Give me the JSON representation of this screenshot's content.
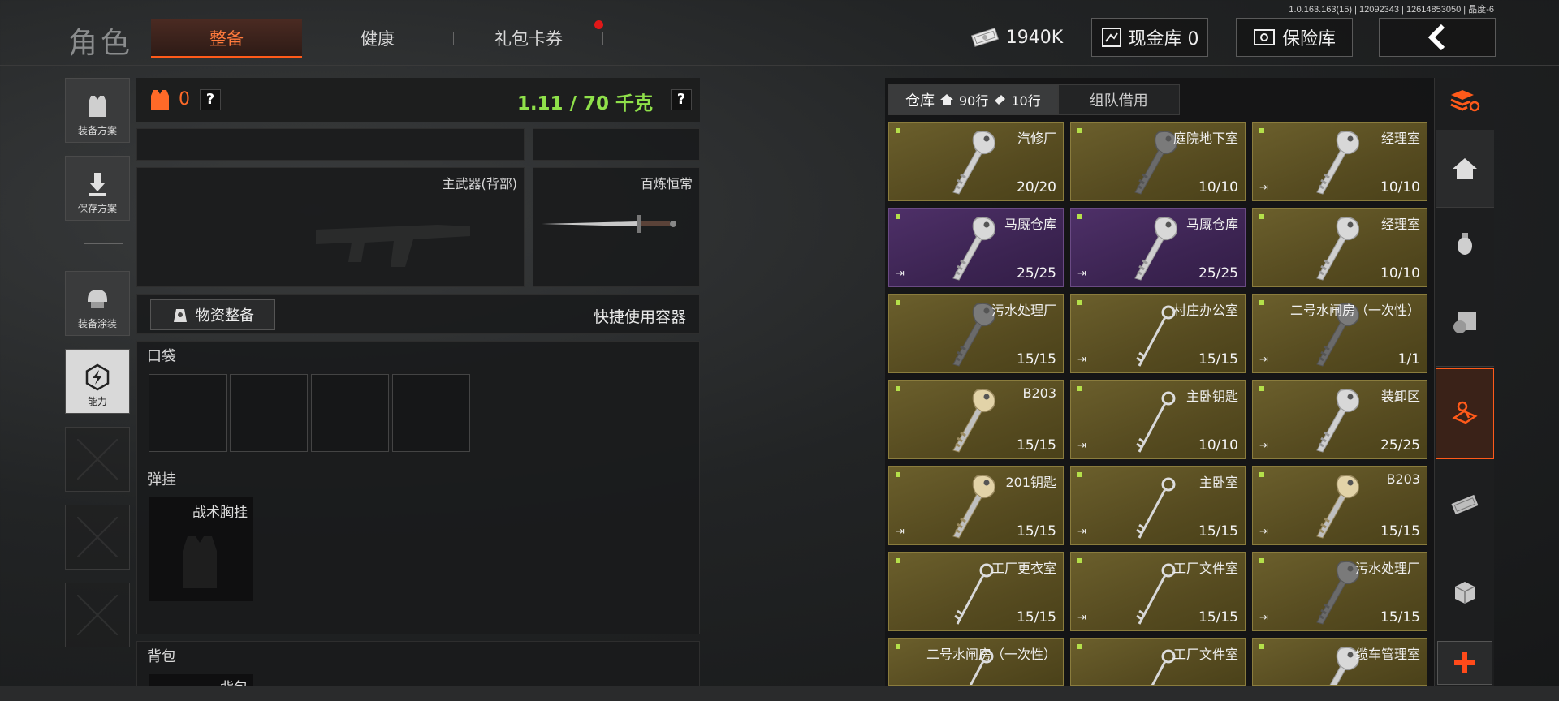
{
  "version_text": "1.0.163.163(15) | 12092343 | 12614853050 | 晶度-6",
  "title": "角色",
  "tabs": [
    "整备",
    "健康",
    "礼包卡券"
  ],
  "top": {
    "money": "1940K",
    "cash_vault": "现金库 0",
    "safe": "保险库"
  },
  "left": {
    "plan": "装备方案",
    "save": "保存方案",
    "skin": "装备涂装",
    "ability": "能力"
  },
  "gear": {
    "armor_count": "0",
    "weight": "1.11 / 70 千克",
    "help": "?",
    "main_weapon_label": "主武器(背部)",
    "melee_label": "百炼恒常",
    "supply_button": "物资整备",
    "quick_container": "快捷使用容器",
    "pocket_label": "口袋",
    "rig_label": "弹挂",
    "rig_item": "战术胸挂",
    "backpack_label": "背包",
    "backpack_item": "背包"
  },
  "warehouse": {
    "tab_storage": "仓库",
    "rows_home": "90行",
    "rows_other": "10行",
    "tab_team": "组队借用",
    "items": [
      {
        "name": "汽修厂",
        "count": "20/20",
        "style": "gold",
        "exit": false,
        "key": "silver"
      },
      {
        "name": "庭院地下室",
        "count": "10/10",
        "style": "gold",
        "exit": false,
        "key": "dark"
      },
      {
        "name": "经理室",
        "count": "10/10",
        "style": "gold",
        "exit": true,
        "key": "silver"
      },
      {
        "name": "马厩仓库",
        "count": "25/25",
        "style": "purple",
        "exit": true,
        "key": "silver"
      },
      {
        "name": "马厩仓库",
        "count": "25/25",
        "style": "purple",
        "exit": true,
        "key": "silver"
      },
      {
        "name": "经理室",
        "count": "10/10",
        "style": "gold",
        "exit": false,
        "key": "silver"
      },
      {
        "name": "污水处理厂",
        "count": "15/15",
        "style": "gold",
        "exit": false,
        "key": "dark"
      },
      {
        "name": "村庄办公室",
        "count": "15/15",
        "style": "gold",
        "exit": true,
        "key": "thin"
      },
      {
        "name": "二号水闸房（一次性）",
        "count": "1/1",
        "style": "gold",
        "exit": true,
        "key": "dark"
      },
      {
        "name": "B203",
        "count": "15/15",
        "style": "gold",
        "exit": false,
        "key": "tan"
      },
      {
        "name": "主卧钥匙",
        "count": "10/10",
        "style": "gold",
        "exit": true,
        "key": "thin"
      },
      {
        "name": "装卸区",
        "count": "25/25",
        "style": "gold",
        "exit": true,
        "key": "silver"
      },
      {
        "name": "201钥匙",
        "count": "15/15",
        "style": "gold",
        "exit": true,
        "key": "tan"
      },
      {
        "name": "主卧室",
        "count": "15/15",
        "style": "gold",
        "exit": true,
        "key": "thin"
      },
      {
        "name": "B203",
        "count": "15/15",
        "style": "gold",
        "exit": true,
        "key": "tan"
      },
      {
        "name": "工厂更衣室",
        "count": "15/15",
        "style": "gold",
        "exit": false,
        "key": "thin"
      },
      {
        "name": "工厂文件室",
        "count": "15/15",
        "style": "gold",
        "exit": true,
        "key": "thin"
      },
      {
        "name": "污水处理厂",
        "count": "15/15",
        "style": "gold",
        "exit": true,
        "key": "dark"
      },
      {
        "name": "二号水闸房（一次性）",
        "count": "",
        "style": "gold",
        "exit": false,
        "key": "thin"
      },
      {
        "name": "工厂文件室",
        "count": "",
        "style": "gold",
        "exit": false,
        "key": "thin"
      },
      {
        "name": "缆车管理室",
        "count": "",
        "style": "gold",
        "exit": false,
        "key": "silver"
      }
    ]
  },
  "right_sidebar": [
    "sort-stack-icon",
    "home-icon",
    "grenade-icon",
    "safe-box-icon",
    "key-icon",
    "cash-icon",
    "crate-icon",
    "add-icon"
  ]
}
